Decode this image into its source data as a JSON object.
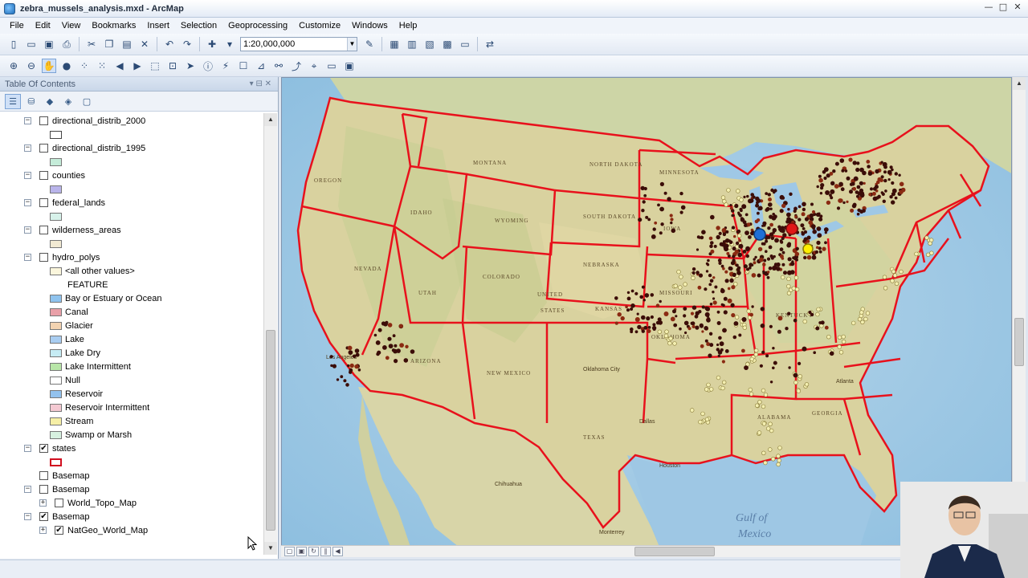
{
  "window": {
    "title": "zebra_mussels_analysis.mxd - ArcMap",
    "minimize": "—",
    "maximize": "□",
    "close": "✕"
  },
  "menu": [
    "File",
    "Edit",
    "View",
    "Bookmarks",
    "Insert",
    "Selection",
    "Geoprocessing",
    "Customize",
    "Windows",
    "Help"
  ],
  "toolbar": {
    "scale": "1:20,000,000"
  },
  "toc": {
    "title": "Table Of Contents",
    "layers": [
      {
        "name": "directional_distrib_2000",
        "checked": false
      },
      {
        "name": "directional_distrib_1995",
        "checked": false
      },
      {
        "name": "counties",
        "checked": false
      },
      {
        "name": "federal_lands",
        "checked": false
      },
      {
        "name": "wilderness_areas",
        "checked": false
      },
      {
        "name": "hydro_polys",
        "checked": false
      }
    ],
    "hydro_legend": {
      "other": "<all other values>",
      "field": "FEATURE",
      "classes": [
        {
          "label": "Bay or Estuary or Ocean",
          "color": "#8fc3ee"
        },
        {
          "label": "Canal",
          "color": "#e9a0a8"
        },
        {
          "label": "Glacier",
          "color": "#f3d3b1"
        },
        {
          "label": "Lake",
          "color": "#a9cdf1"
        },
        {
          "label": "Lake Dry",
          "color": "#c6ecf4"
        },
        {
          "label": "Lake Intermittent",
          "color": "#b8e6a8"
        },
        {
          "label": "Null",
          "color": "#ffffff"
        },
        {
          "label": "Reservoir",
          "color": "#93c2ee"
        },
        {
          "label": "Reservoir Intermittent",
          "color": "#f4c9d2"
        },
        {
          "label": "Stream",
          "color": "#f6efa6"
        },
        {
          "label": "Swamp or Marsh",
          "color": "#d7f1e0"
        }
      ]
    },
    "states": {
      "name": "states",
      "checked": true
    },
    "basemap_groups": [
      {
        "name": "Basemap",
        "checked": false,
        "expander": false
      },
      {
        "name": "Basemap",
        "checked": false,
        "expander": true,
        "child": {
          "name": "World_Topo_Map",
          "checked": false
        }
      },
      {
        "name": "Basemap",
        "checked": true,
        "expander": true,
        "child": {
          "name": "NatGeo_World_Map",
          "checked": true
        }
      }
    ]
  },
  "map": {
    "country_label_1": "UNITED",
    "country_label_2": "STATES",
    "gulf_1": "Gulf of",
    "gulf_2": "Mexico",
    "states": [
      "MONTANA",
      "NORTH DAKOTA",
      "SOUTH DAKOTA",
      "NEBRASKA",
      "KANSAS",
      "TEXAS",
      "NEVADA",
      "ARIZONA",
      "NEW MEXICO",
      "IDAHO",
      "OREGON",
      "WYOMING",
      "COLORADO",
      "UTAH",
      "OKLAHOMA",
      "IOWA",
      "MISSOURI",
      "ALABAMA",
      "GEORGIA",
      "KENTUCKY",
      "MINNESOTA"
    ],
    "cities": [
      "Los Angeles",
      "Dallas",
      "Houston",
      "Oklahoma City",
      "Atlanta",
      "Chihuahua",
      "Monterrey"
    ],
    "colors": {
      "land": "#d9d29f",
      "water": "#a8cde6",
      "state_line": "#e8111c",
      "points_dark": "#3b0d08",
      "points_light": "#f4efb1",
      "dot_blue": "#1e6fd6",
      "dot_red": "#e01717",
      "dot_yellow": "#ffee00"
    }
  }
}
